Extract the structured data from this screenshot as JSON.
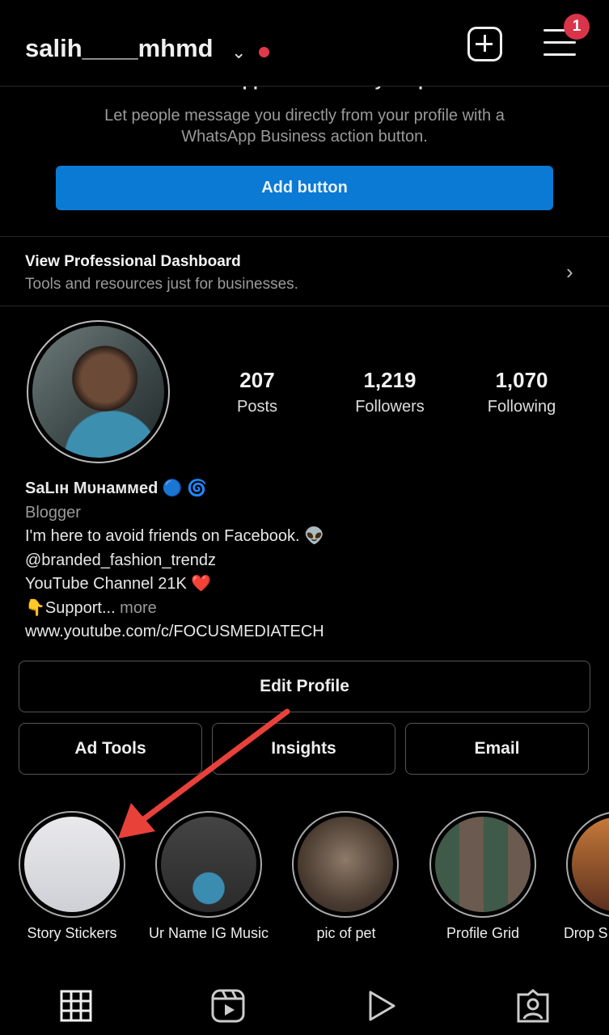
{
  "header": {
    "username": "salih____mhmd",
    "notification_count": "1",
    "icons": [
      "chevron-down-icon",
      "new-post-icon",
      "menu-icon"
    ]
  },
  "whatsapp": {
    "title": "Add WhatsApp Business to your profile",
    "description": "Let people message you directly from your profile with a WhatsApp Business action button.",
    "button": "Add button"
  },
  "dashboard": {
    "title": "View Professional Dashboard",
    "subtitle": "Tools and resources just for businesses."
  },
  "stats": [
    {
      "value": "207",
      "label": "Posts"
    },
    {
      "value": "1,219",
      "label": "Followers"
    },
    {
      "value": "1,070",
      "label": "Following"
    }
  ],
  "bio": {
    "name": "SaLιн Mυнaммed",
    "name_emoji": "🔵 🌀",
    "category": "Blogger",
    "line1": "I'm here to avoid friends on Facebook. 👽",
    "line2": "@branded_fashion_trendz",
    "line3": "YouTube Channel 21K ❤️",
    "line4": "👇Support...",
    "more": " more",
    "link": "www.youtube.com/c/FOCUSMEDIATECH"
  },
  "buttons": {
    "edit": "Edit Profile",
    "ad_tools": "Ad Tools",
    "insights": "Insights",
    "email": "Email"
  },
  "highlights": [
    {
      "label": "Story Stickers"
    },
    {
      "label": "Ur Name IG Music"
    },
    {
      "label": "pic of pet"
    },
    {
      "label": "Profile Grid"
    },
    {
      "label": "Drop S"
    }
  ],
  "colors": {
    "accent": "#0a7ad4",
    "badge": "#d9344a",
    "arrow": "#e8413a"
  },
  "nav": [
    "grid-icon",
    "reels-icon",
    "play-icon",
    "tagged-icon"
  ]
}
